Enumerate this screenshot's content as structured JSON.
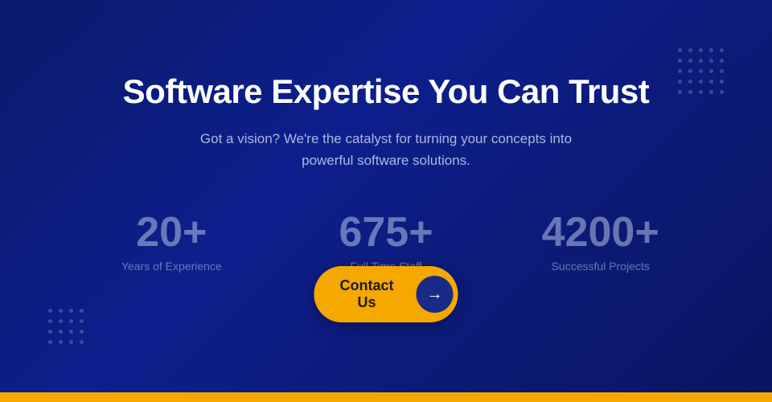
{
  "page": {
    "heading": "Software Expertise You Can Trust",
    "subheading": "Got a vision? We're the catalyst for turning your concepts into powerful software solutions.",
    "stats": [
      {
        "number": "20+",
        "label": "Years of Experience"
      },
      {
        "number": "675+",
        "label": "Full Time Staff"
      },
      {
        "number": "4200+",
        "label": "Successful Projects"
      }
    ],
    "contact_button": {
      "label": "Contact Us",
      "arrow": "→"
    }
  },
  "colors": {
    "background_start": "#0a1a6b",
    "background_end": "#0a1560",
    "accent": "#f5a800",
    "bottom_bar": "#f5a800"
  },
  "dot_grid": {
    "top_right_rows": 5,
    "top_right_cols": 5,
    "bottom_left_rows": 4,
    "bottom_left_cols": 4
  }
}
